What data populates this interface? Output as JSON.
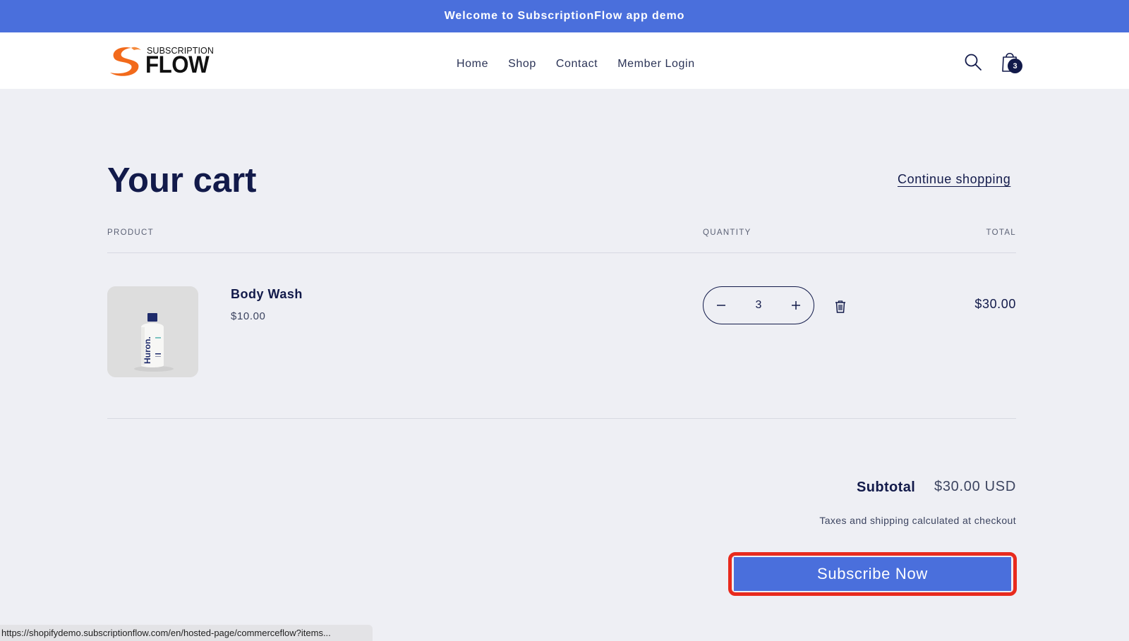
{
  "announcement": {
    "text": "Welcome to SubscriptionFlow app demo"
  },
  "brand": {
    "top_word": "SUBSCRIPTION",
    "main_word": "FLOW"
  },
  "nav": {
    "items": [
      {
        "label": "Home"
      },
      {
        "label": "Shop"
      },
      {
        "label": "Contact"
      },
      {
        "label": "Member Login"
      }
    ]
  },
  "cart_badge": {
    "count": "3"
  },
  "page": {
    "title": "Your cart",
    "continue_label": "Continue shopping"
  },
  "table": {
    "headers": {
      "product": "PRODUCT",
      "quantity": "QUANTITY",
      "total": "TOTAL"
    },
    "rows": [
      {
        "name": "Body Wash",
        "price": "$10.00",
        "quantity": "3",
        "total": "$30.00",
        "image_brand_text": "Huron."
      }
    ]
  },
  "summary": {
    "subtotal_label": "Subtotal",
    "subtotal_value": "$30.00 USD",
    "tax_note": "Taxes and shipping calculated at checkout",
    "subscribe_label": "Subscribe Now"
  },
  "status_bar": {
    "url": "https://shopifydemo.subscriptionflow.com/en/hosted-page/commerceflow?items..."
  },
  "colors": {
    "accent": "#4a6fdc",
    "text_dark": "#121a4a",
    "page_bg": "#eeeff4",
    "highlight": "#e82a1d",
    "logo_orange": "#f26a1b"
  },
  "icons": {
    "search": "search-icon",
    "cart": "cart-icon",
    "trash": "trash-icon",
    "minus": "minus-icon",
    "plus": "plus-icon"
  }
}
